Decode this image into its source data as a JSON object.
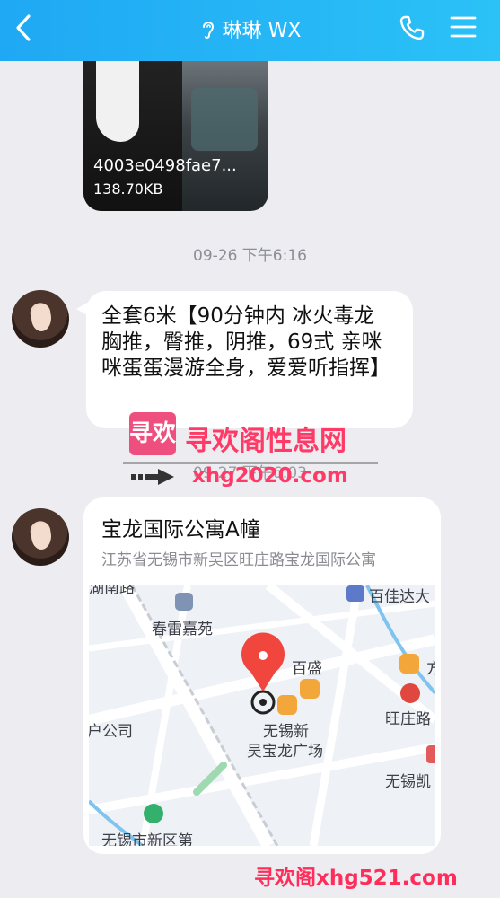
{
  "header": {
    "title": "琳琳 WX"
  },
  "file_message": {
    "name": "4003e0498fae7...",
    "size": "138.70KB"
  },
  "timestamps": {
    "first": "09-26 下午6:16",
    "second": "09-27 下午6:03"
  },
  "text_message": {
    "content": "全套6米【90分钟内 冰火毒龙 胸推，臀推，阴推，69式 亲咪咪蛋蛋漫游全身，爱爱听指挥】"
  },
  "watermark": {
    "logo": "寻欢",
    "site_name": "寻欢阁性息网",
    "url_top": "xhg2020.com",
    "bottom": "寻欢阁xhg521.com"
  },
  "location_message": {
    "title": "宝龙国际公寓A幢",
    "address": "江苏省无锡市新吴区旺庄路宝龙国际公寓",
    "map_labels": {
      "top_left": "湖南路",
      "chunlei": "春雷嘉苑",
      "top_right": "百佳达大",
      "baisheng": "百盛",
      "wangzhuang": "旺庄路",
      "right_edge": "方",
      "company": "户公司",
      "plaza_line1": "无锡新",
      "plaza_line2": "吴宝龙广场",
      "wuxi_kai": "无锡凯",
      "bottom_left": "无锡市新区第"
    }
  },
  "colors": {
    "header_bg": "#22b0f5",
    "pin": "#f0463e",
    "poi": "#f3a73b",
    "watermark": "#ff3a66"
  }
}
